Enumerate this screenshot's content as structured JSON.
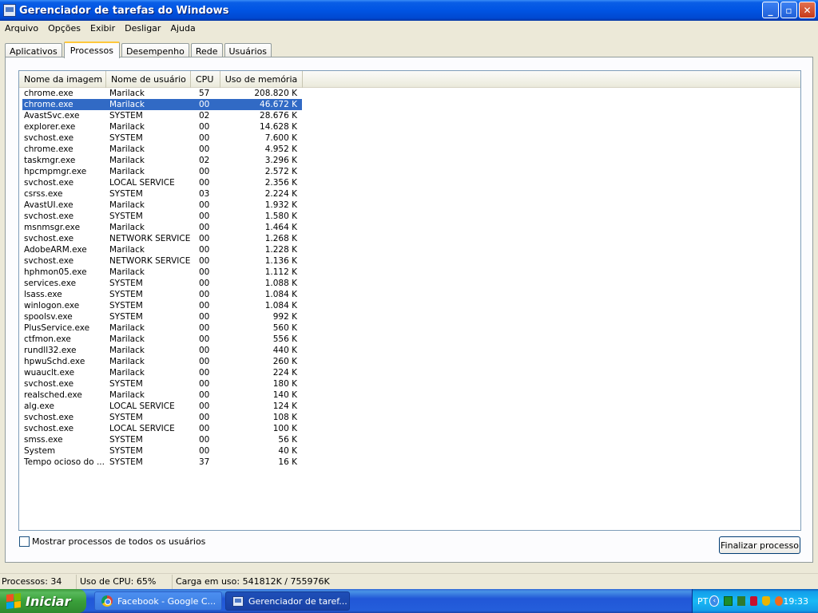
{
  "window": {
    "title": "Gerenciador de tarefas do Windows",
    "buttons": {
      "minimize": "_",
      "restore": "▫",
      "close": "✕"
    }
  },
  "menu": [
    "Arquivo",
    "Opções",
    "Exibir",
    "Desligar",
    "Ajuda"
  ],
  "tabs": [
    {
      "label": "Aplicativos",
      "active": false
    },
    {
      "label": "Processos",
      "active": true
    },
    {
      "label": "Desempenho",
      "active": false
    },
    {
      "label": "Rede",
      "active": false
    },
    {
      "label": "Usuários",
      "active": false
    }
  ],
  "table": {
    "headers": [
      "Nome da imagem",
      "Nome de usuário",
      "CPU",
      "Uso de memória"
    ],
    "selected_index": 1,
    "rows": [
      [
        "chrome.exe",
        "Marilack",
        "57",
        "208.820 K"
      ],
      [
        "chrome.exe",
        "Marilack",
        "00",
        "46.672 K"
      ],
      [
        "AvastSvc.exe",
        "SYSTEM",
        "02",
        "28.676 K"
      ],
      [
        "explorer.exe",
        "Marilack",
        "00",
        "14.628 K"
      ],
      [
        "svchost.exe",
        "SYSTEM",
        "00",
        "7.600 K"
      ],
      [
        "chrome.exe",
        "Marilack",
        "00",
        "4.952 K"
      ],
      [
        "taskmgr.exe",
        "Marilack",
        "02",
        "3.296 K"
      ],
      [
        "hpcmpmgr.exe",
        "Marilack",
        "00",
        "2.572 K"
      ],
      [
        "svchost.exe",
        "LOCAL SERVICE",
        "00",
        "2.356 K"
      ],
      [
        "csrss.exe",
        "SYSTEM",
        "03",
        "2.224 K"
      ],
      [
        "AvastUI.exe",
        "Marilack",
        "00",
        "1.932 K"
      ],
      [
        "svchost.exe",
        "SYSTEM",
        "00",
        "1.580 K"
      ],
      [
        "msnmsgr.exe",
        "Marilack",
        "00",
        "1.464 K"
      ],
      [
        "svchost.exe",
        "NETWORK SERVICE",
        "00",
        "1.268 K"
      ],
      [
        "AdobeARM.exe",
        "Marilack",
        "00",
        "1.228 K"
      ],
      [
        "svchost.exe",
        "NETWORK SERVICE",
        "00",
        "1.136 K"
      ],
      [
        "hphmon05.exe",
        "Marilack",
        "00",
        "1.112 K"
      ],
      [
        "services.exe",
        "SYSTEM",
        "00",
        "1.088 K"
      ],
      [
        "lsass.exe",
        "SYSTEM",
        "00",
        "1.084 K"
      ],
      [
        "winlogon.exe",
        "SYSTEM",
        "00",
        "1.084 K"
      ],
      [
        "spoolsv.exe",
        "SYSTEM",
        "00",
        "992 K"
      ],
      [
        "PlusService.exe",
        "Marilack",
        "00",
        "560 K"
      ],
      [
        "ctfmon.exe",
        "Marilack",
        "00",
        "556 K"
      ],
      [
        "rundll32.exe",
        "Marilack",
        "00",
        "440 K"
      ],
      [
        "hpwuSchd.exe",
        "Marilack",
        "00",
        "260 K"
      ],
      [
        "wuauclt.exe",
        "Marilack",
        "00",
        "224 K"
      ],
      [
        "svchost.exe",
        "SYSTEM",
        "00",
        "180 K"
      ],
      [
        "realsched.exe",
        "Marilack",
        "00",
        "140 K"
      ],
      [
        "alg.exe",
        "LOCAL SERVICE",
        "00",
        "124 K"
      ],
      [
        "svchost.exe",
        "SYSTEM",
        "00",
        "108 K"
      ],
      [
        "svchost.exe",
        "LOCAL SERVICE",
        "00",
        "100 K"
      ],
      [
        "smss.exe",
        "SYSTEM",
        "00",
        "56 K"
      ],
      [
        "System",
        "SYSTEM",
        "00",
        "40 K"
      ],
      [
        "Tempo ocioso do ...",
        "SYSTEM",
        "37",
        "16 K"
      ]
    ]
  },
  "show_all_checkbox": {
    "label": "Mostrar processos de todos os usuários",
    "checked": false
  },
  "end_process_button": "Finalizar processo",
  "status": {
    "processes": "Processos: 34",
    "cpu": "Uso de CPU: 65%",
    "commit": "Carga em uso: 541812K / 755976K"
  },
  "taskbar": {
    "start_label": "Iniciar",
    "tasks": [
      {
        "label": "Facebook - Google C...",
        "icon": "chrome-icon"
      },
      {
        "label": "Gerenciador de taref...",
        "icon": "task-manager-icon"
      }
    ],
    "tray": {
      "language": "PT",
      "clock": "19:33"
    }
  },
  "colors": {
    "selection": "#316ac5",
    "title_bar": "#0054e3",
    "start_button": "#3aa03a",
    "tray": "#139ee9"
  }
}
